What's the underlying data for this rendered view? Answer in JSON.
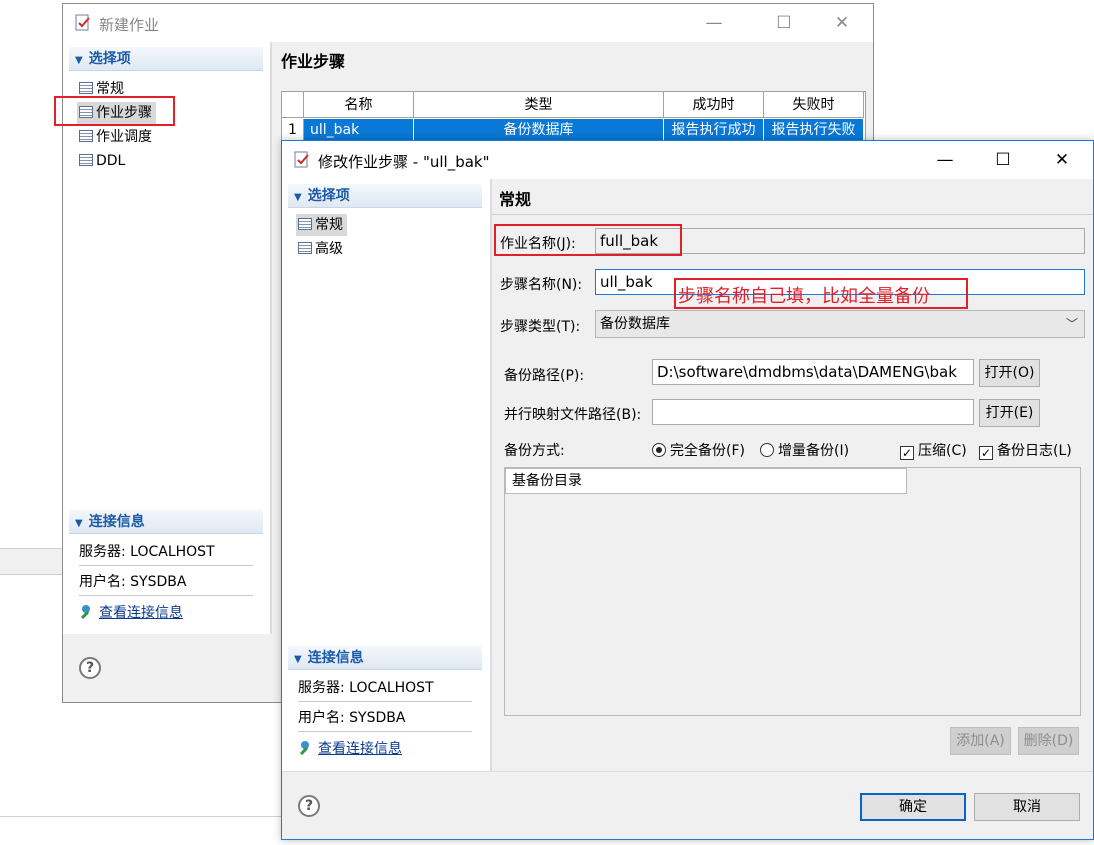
{
  "back_window": {
    "title": "新建作业",
    "left_section": "选择项",
    "nav": [
      "常规",
      "作业步骤",
      "作业调度",
      "DDL"
    ],
    "conn_section": "连接信息",
    "server": "服务器: LOCALHOST",
    "user": "用户名: SYSDBA",
    "conn_link": "查看连接信息",
    "main_title": "作业步骤",
    "grid": {
      "headers": [
        "名称",
        "类型",
        "成功时",
        "失败时"
      ],
      "row": {
        "index": "1",
        "name": "ull_bak",
        "type": "备份数据库",
        "success": "报告执行成功",
        "fail": "报告执行失败"
      }
    }
  },
  "dialog": {
    "title": "修改作业步骤 - \"ull_bak\"",
    "left_section": "选择项",
    "nav": [
      "常规",
      "高级"
    ],
    "conn_section": "连接信息",
    "server": "服务器: LOCALHOST",
    "user": "用户名: SYSDBA",
    "conn_link": "查看连接信息",
    "main_title": "常规",
    "job_name_label": "作业名称(J):",
    "job_name_value": "full_bak",
    "step_name_label": "步骤名称(N):",
    "step_name_value": "ull_bak",
    "step_type_label": "步骤类型(T):",
    "step_type_value": "备份数据库",
    "backup_path_label": "备份路径(P):",
    "backup_path_value": "D:\\software\\dmdbms\\data\\DAMENG\\bak",
    "open_p": "打开(O)",
    "map_path_label": "并行映射文件路径(B):",
    "map_path_value": "",
    "open_e": "打开(E)",
    "backup_mode_label": "备份方式:",
    "full_backup": "完全备份(F)",
    "incr_backup": "增量备份(I)",
    "compress": "压缩(C)",
    "backup_log": "备份日志(L)",
    "base_dir_header": "基备份目录",
    "add_btn": "添加(A)",
    "del_btn": "删除(D)",
    "ok_btn": "确定",
    "cancel_btn": "取消"
  },
  "annotation": "步骤名称自己填，比如全量备份",
  "colors": {
    "selection": "#0a78d7",
    "annotation": "#e3202a",
    "section_text": "#1a5aa6"
  }
}
